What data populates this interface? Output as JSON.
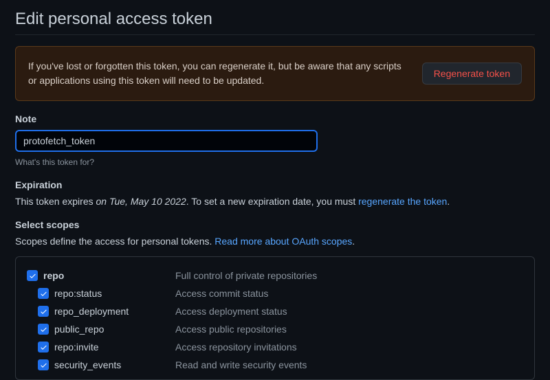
{
  "page": {
    "title": "Edit personal access token"
  },
  "alert": {
    "text": "If you've lost or forgotten this token, you can regenerate it, but be aware that any scripts or applications using this token will need to be updated.",
    "button": "Regenerate token"
  },
  "note": {
    "label": "Note",
    "value": "protofetch_token",
    "hint": "What's this token for?"
  },
  "expiration": {
    "label": "Expiration",
    "prefix": "This token expires ",
    "date": "on Tue, May 10 2022",
    "suffix": ". To set a new expiration date, you must ",
    "link": "regenerate the token",
    "tail": "."
  },
  "scopes": {
    "label": "Select scopes",
    "desc_prefix": "Scopes define the access for personal tokens. ",
    "desc_link": "Read more about OAuth scopes",
    "desc_tail": ".",
    "items": [
      {
        "name": "repo",
        "desc": "Full control of private repositories",
        "parent": true
      },
      {
        "name": "repo:status",
        "desc": "Access commit status",
        "parent": false
      },
      {
        "name": "repo_deployment",
        "desc": "Access deployment status",
        "parent": false
      },
      {
        "name": "public_repo",
        "desc": "Access public repositories",
        "parent": false
      },
      {
        "name": "repo:invite",
        "desc": "Access repository invitations",
        "parent": false
      },
      {
        "name": "security_events",
        "desc": "Read and write security events",
        "parent": false
      }
    ]
  }
}
